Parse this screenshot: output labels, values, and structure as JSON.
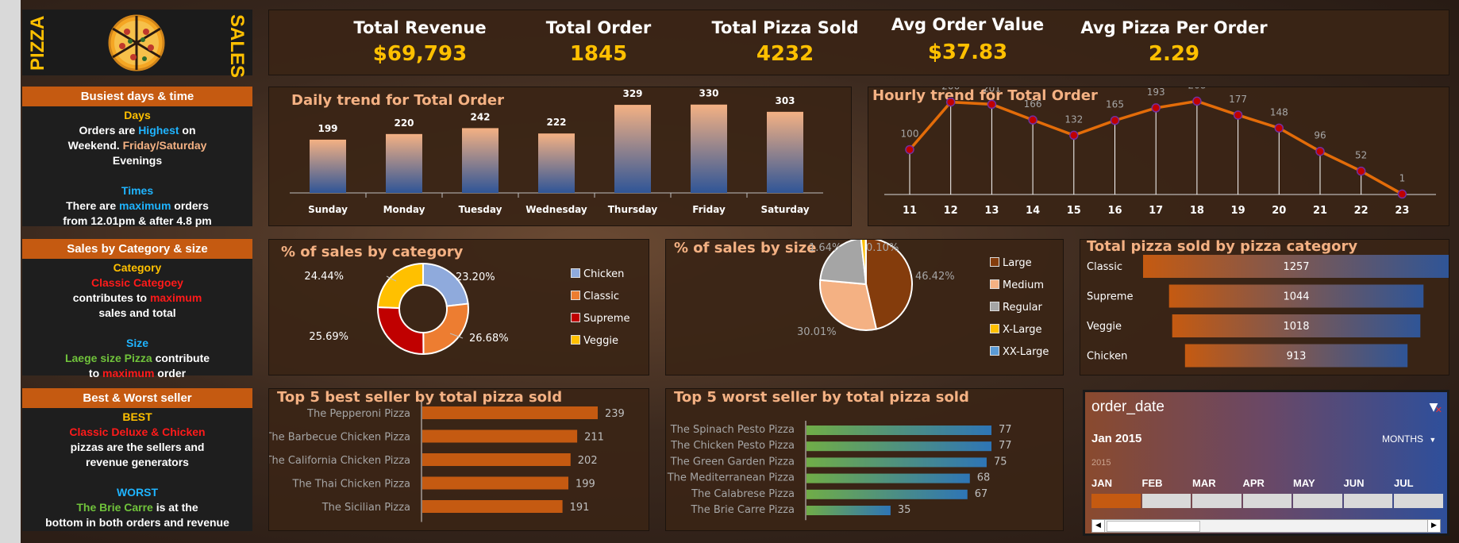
{
  "logo": {
    "left_text": "PIZZA",
    "right_text": "SALES"
  },
  "kpis": [
    {
      "label": "Total Revenue",
      "value": "$69,793"
    },
    {
      "label": "Total Order",
      "value": "1845"
    },
    {
      "label": "Total Pizza Sold",
      "value": "4232"
    },
    {
      "label": "Avg Order Value",
      "value": "$37.83"
    },
    {
      "label": "Avg Pizza Per Order",
      "value": "2.29"
    }
  ],
  "side": {
    "busiest": {
      "title": "Busiest days & time",
      "days_head": "Days",
      "l1a": "Orders are ",
      "l1b": "Highest",
      "l1c": " on",
      "l2a": "Weekend. ",
      "l2b": "Friday/Saturday",
      "l3": "Evenings",
      "times_head": "Times",
      "l4a": "There are ",
      "l4b": "maximum",
      "l4c": " orders",
      "l5": "from 12.01pm & after 4.8 pm"
    },
    "category": {
      "title": "Sales by Category & size",
      "cat_head": "Category",
      "l1": "Classic Categoey",
      "l2a": "contributes to ",
      "l2b": "maximum",
      "l3": "sales and total",
      "size_head": "Size",
      "l4a": "Laege size Pizza",
      "l4b": " contribute",
      "l5a": "to  ",
      "l5b": "maximum",
      "l5c": " order"
    },
    "seller": {
      "title": "Best & Worst seller",
      "best_head": "BEST",
      "l1": "Classic Deluxe & Chicken",
      "l2": "pizzas are the sellers and",
      "l3": "revenue generators",
      "worst_head": "WORST",
      "l4a": "The Brie Carre",
      "l4b": " is at the",
      "l5": "bottom in both orders and revenue"
    }
  },
  "slicer": {
    "title": "order_date",
    "selected": "Jan 2015",
    "level": "MONTHS",
    "year": "2015",
    "months": [
      "JAN",
      "FEB",
      "MAR",
      "APR",
      "MAY",
      "JUN",
      "JUL"
    ],
    "selected_index": 0,
    "colors": {
      "selected": "#c55a11",
      "unselected": "#d9d9d9"
    }
  },
  "chart_data": [
    {
      "type": "bar",
      "title": "Daily trend for Total Order",
      "categories": [
        "Sunday",
        "Monday",
        "Tuesday",
        "Wednesday",
        "Thursday",
        "Friday",
        "Saturday"
      ],
      "values": [
        199,
        220,
        242,
        222,
        329,
        330,
        303
      ],
      "ylim": [
        0,
        350
      ],
      "colors": {
        "top": "#f4b183",
        "bottom": "#2f5597"
      }
    },
    {
      "type": "line",
      "title": "Hourly trend for Total Order",
      "x": [
        11,
        12,
        13,
        14,
        15,
        16,
        17,
        18,
        19,
        20,
        21,
        22,
        23
      ],
      "values": [
        100,
        206,
        201,
        166,
        132,
        165,
        193,
        208,
        177,
        148,
        96,
        52,
        1
      ],
      "ylim": [
        0,
        230
      ],
      "colors": {
        "line": "#e36c09",
        "marker": "#c00000"
      }
    },
    {
      "type": "pie",
      "title": "% of sales by category",
      "donut": true,
      "labels": [
        "Chicken",
        "Classic",
        "Supreme",
        "Veggie"
      ],
      "values": [
        23.2,
        26.68,
        25.69,
        24.44
      ],
      "data_labels": [
        "23.20%",
        "26.68%",
        "25.69%",
        "24.44%"
      ],
      "colors": [
        "#8faadc",
        "#ed7d31",
        "#c00000",
        "#ffc000"
      ]
    },
    {
      "type": "pie",
      "title": "% of sales by size",
      "labels": [
        "Large",
        "Medium",
        "Regular",
        "X-Large",
        "XX-Large"
      ],
      "values": [
        46.42,
        30.01,
        21.83,
        1.64,
        0.1
      ],
      "data_labels": [
        "46.42%",
        "30.01%",
        "",
        "1.64%",
        "0.10%"
      ],
      "colors": [
        "#843c0c",
        "#f4b183",
        "#a5a5a5",
        "#ffc000",
        "#5b9bd5"
      ]
    },
    {
      "type": "bar",
      "orientation": "funnel",
      "title": "Total pizza sold by pizza category",
      "categories": [
        "Classic",
        "Supreme",
        "Veggie",
        "Chicken"
      ],
      "values": [
        1257,
        1044,
        1018,
        913
      ],
      "colors": {
        "left": "#c55a11",
        "right": "#2f5597"
      }
    },
    {
      "type": "bar",
      "orientation": "horizontal",
      "title": "Top 5 best seller by total pizza sold",
      "categories": [
        "The Pepperoni Pizza",
        "The Barbecue Chicken Pizza",
        "The California Chicken Pizza",
        "The Thai Chicken Pizza",
        "The Sicilian Pizza"
      ],
      "values": [
        239,
        211,
        202,
        199,
        191
      ],
      "colors": {
        "bar": "#c55a11"
      }
    },
    {
      "type": "bar",
      "orientation": "horizontal",
      "title": "Top 5 worst  seller by total pizza sold",
      "categories": [
        "The Spinach Pesto Pizza",
        "The Chicken Pesto Pizza",
        "The Green Garden Pizza",
        "The Mediterranean Pizza",
        "The Calabrese Pizza",
        "The Brie Carre Pizza"
      ],
      "values": [
        77,
        77,
        75,
        68,
        67,
        35
      ],
      "colors": {
        "left": "#70ad47",
        "right": "#2e75b6"
      }
    }
  ]
}
